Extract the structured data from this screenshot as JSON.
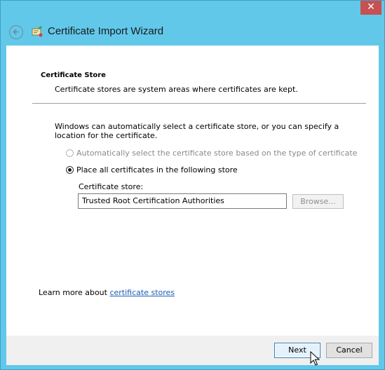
{
  "window": {
    "title": "Certificate Import Wizard"
  },
  "header": {
    "section_title": "Certificate Store",
    "section_subtitle": "Certificate stores are system areas where certificates are kept."
  },
  "body": {
    "intro": "Windows can automatically select a certificate store, or you can specify a location for the certificate.",
    "options": [
      {
        "label": "Automatically select the certificate store based on the type of certificate",
        "selected": false,
        "enabled": false
      },
      {
        "label": "Place all certificates in the following store",
        "selected": true,
        "enabled": true
      }
    ],
    "store_label": "Certificate store:",
    "store_value": "Trusted Root Certification Authorities",
    "browse_label": "Browse..."
  },
  "learn_more": {
    "prefix": "Learn more about ",
    "link": "certificate stores"
  },
  "footer": {
    "next_label": "Next",
    "cancel_label": "Cancel"
  },
  "icons": {
    "close": "close-icon",
    "back": "back-arrow-icon",
    "wizard": "certificate-wizard-icon",
    "cursor": "mouse-pointer-icon"
  },
  "colors": {
    "frame": "#62c8ea",
    "close": "#c75050",
    "link": "#1a5fb4"
  }
}
